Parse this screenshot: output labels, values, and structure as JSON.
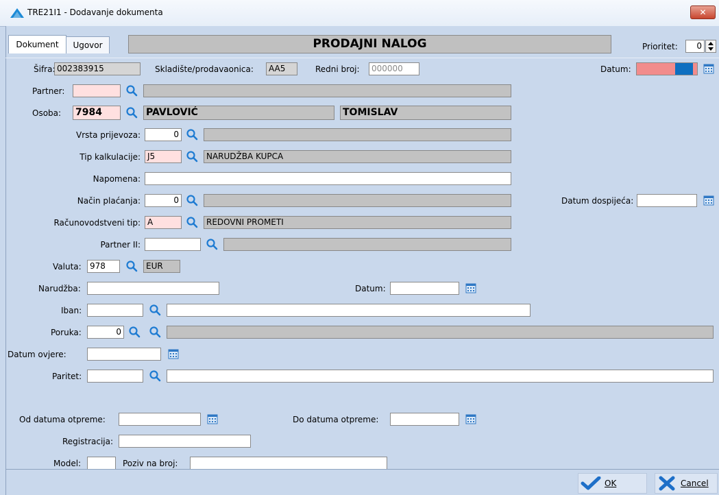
{
  "window": {
    "title": "TRE21I1 - Dodavanje dokumenta",
    "close": "✕"
  },
  "tabs": [
    {
      "label": "Dokument"
    },
    {
      "label": "Ugovor"
    }
  ],
  "banner": "PRODAJNI NALOG",
  "prioritet": {
    "label": "Prioritet:",
    "value": "0"
  },
  "sifra": {
    "label": "Šifra:",
    "value": "002383915"
  },
  "skladiste": {
    "label": "Skladište/prodavaonica:",
    "value": "AA5"
  },
  "redni_broj": {
    "label": "Redni broj:",
    "value": "000000"
  },
  "datum_top": {
    "label": "Datum:"
  },
  "partner": {
    "label": "Partner:",
    "code": "",
    "name": ""
  },
  "osoba": {
    "label": "Osoba:",
    "code": "7984",
    "surname": "PAVLOVIĆ",
    "firstname": "TOMISLAV"
  },
  "vrsta_prijevoza": {
    "label": "Vrsta prijevoza:",
    "code": "0",
    "desc": ""
  },
  "tip_kalkulacije": {
    "label": "Tip kalkulacije:",
    "code": "J5",
    "desc": "NARUDŽBA KUPCA"
  },
  "napomena": {
    "label": "Napomena:",
    "value": ""
  },
  "nacin_placanja": {
    "label": "Način plaćanja:",
    "code": "0",
    "desc": ""
  },
  "datum_dospijeca": {
    "label": "Datum dospijeća:",
    "value": ""
  },
  "racunovodstveni_tip": {
    "label": "Računovodstveni tip:",
    "code": "A",
    "desc": "REDOVNI PROMETI"
  },
  "partner_ii": {
    "label": "Partner II:",
    "code": "",
    "desc": ""
  },
  "valuta": {
    "label": "Valuta:",
    "code": "978",
    "desc": "EUR"
  },
  "narudzba": {
    "label": "Narudžba:",
    "value": ""
  },
  "datum_narudzbe": {
    "label": "Datum:",
    "value": ""
  },
  "iban": {
    "label": "Iban:",
    "code": "",
    "value": ""
  },
  "poruka": {
    "label": "Poruka:",
    "code": "0",
    "value": ""
  },
  "datum_ovjere": {
    "label": "Datum ovjere:",
    "value": ""
  },
  "paritet": {
    "label": "Paritet:",
    "code": "",
    "value": ""
  },
  "od_datuma_otpreme": {
    "label": "Od datuma otpreme:",
    "value": ""
  },
  "do_datuma_otpreme": {
    "label": "Do datuma otpreme:",
    "value": ""
  },
  "registracija": {
    "label": "Registracija:",
    "value": ""
  },
  "model": {
    "label": "Model:",
    "value": ""
  },
  "poziv_na_broj": {
    "label": "Poziv na broj:",
    "value": ""
  },
  "buttons": {
    "ok": "OK",
    "cancel": "Cancel"
  },
  "colors": {
    "accent": "#0e6fc0",
    "required": "#ffe0e0",
    "date_pink": "#f28c8c"
  }
}
